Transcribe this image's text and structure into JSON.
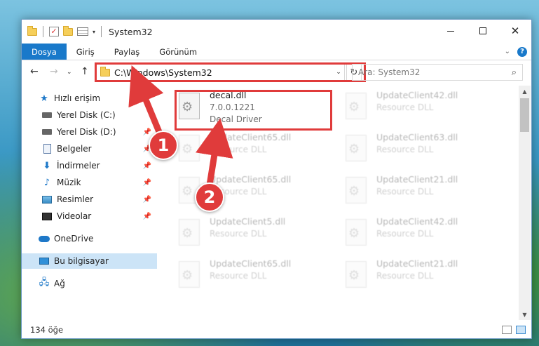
{
  "window": {
    "title": "System32"
  },
  "ribbon": {
    "tabs": [
      "Dosya",
      "Giriş",
      "Paylaş",
      "Görünüm"
    ]
  },
  "address": {
    "path": "C:\\Windows\\System32",
    "search_placeholder": "Ara: System32"
  },
  "sidebar": {
    "items": [
      {
        "label": "Hızlı erişim",
        "icon": "star-icon",
        "pinned": false
      },
      {
        "label": "Yerel Disk (C:)",
        "icon": "drive-icon",
        "pinned": false
      },
      {
        "label": "Yerel Disk (D:)",
        "icon": "drive-icon",
        "pinned": true
      },
      {
        "label": "Belgeler",
        "icon": "documents-icon",
        "pinned": true
      },
      {
        "label": "İndirmeler",
        "icon": "download-icon",
        "pinned": true
      },
      {
        "label": "Müzik",
        "icon": "music-icon",
        "pinned": true
      },
      {
        "label": "Resimler",
        "icon": "pictures-icon",
        "pinned": true
      },
      {
        "label": "Videolar",
        "icon": "videos-icon",
        "pinned": true
      },
      {
        "label": "OneDrive",
        "icon": "cloud-icon",
        "pinned": false
      },
      {
        "label": "Bu bilgisayar",
        "icon": "computer-icon",
        "pinned": false,
        "selected": true
      },
      {
        "label": "Ağ",
        "icon": "network-icon",
        "pinned": false
      }
    ]
  },
  "files": [
    {
      "name": "decal.dll",
      "version": "7.0.0.1221",
      "description": "Decal Driver",
      "highlighted": true
    },
    {
      "name": "UpdateClient42.dll",
      "description": "Resource DLL"
    },
    {
      "name": "UpdateClient65.dll",
      "description": "Resource DLL"
    },
    {
      "name": "UpdateClient63.dll",
      "description": "Resource DLL"
    },
    {
      "name": "UpdateClient65.dll",
      "description": "Resource DLL"
    },
    {
      "name": "UpdateClient21.dll",
      "description": "Resource DLL"
    },
    {
      "name": "UpdateClient5.dll",
      "description": "Resource DLL"
    },
    {
      "name": "UpdateClient42.dll",
      "description": "Resource DLL"
    },
    {
      "name": "UpdateClient65.dll",
      "description": "Resource DLL"
    },
    {
      "name": "UpdateClient21.dll",
      "description": "Resource DLL"
    }
  ],
  "status": {
    "item_count": "134 öğe"
  },
  "callouts": {
    "badge1": "1",
    "badge2": "2"
  },
  "colors": {
    "accent": "#1979ca",
    "highlight_red": "#e03b3b",
    "selected_bg": "#cce4f7"
  }
}
